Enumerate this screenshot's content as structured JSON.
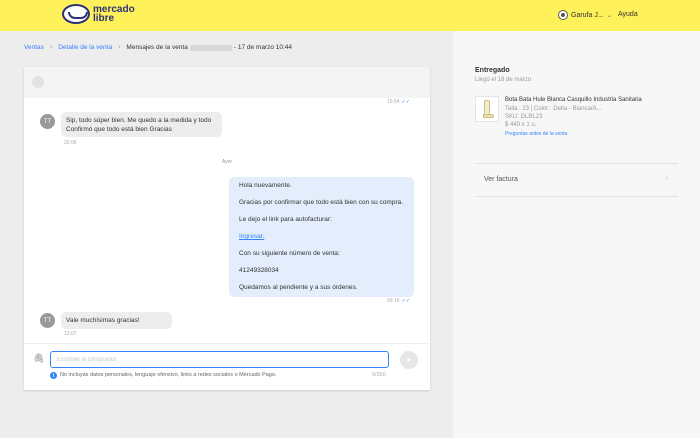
{
  "header": {
    "logo_line1": "mercado",
    "logo_line2": "libre",
    "user_name": "Garufa J...",
    "help": "Ayuda",
    "colors": {
      "topbar": "#fff159",
      "accent": "#3483fa"
    }
  },
  "breadcrumb": {
    "items": [
      "Ventas",
      "Detalle de la venta"
    ],
    "current_prefix": "Mensajes de la venta",
    "current_suffix": "- 17 de marzo 10:44"
  },
  "chat": {
    "top_time": "15:54",
    "messages_in": [
      {
        "avatar": "TT",
        "line1": "Sip, todo súper bien. Me quedo a la medida y todo",
        "line2": "Confirmó que todo está bien Gracias",
        "time": "20:06"
      },
      {
        "avatar": "TT",
        "text": "Vale muchísimas gracias!",
        "time": "12:07"
      }
    ],
    "day_separator": "Ayer",
    "message_out": {
      "line1": "Hola nuevamente.",
      "line2": "Gracias por confirmar que todo está bien con su compra.",
      "line3": "Le dejo el link para autofacturar:",
      "link": "Ingresar.",
      "line5": "Con su siguiente número de venta:",
      "line6": "41249328034",
      "line7": "Quedamos al pendiente y a sus órdenes.",
      "time": "09:16"
    },
    "compose": {
      "placeholder": "Escribile al comprador",
      "info": "No incluyas datos personales, lenguaje ofensivo, links a redes sociales o Mercado Pago.",
      "counter": "0/350"
    }
  },
  "sale": {
    "status": "Entregado",
    "arrived": "Llegó el 18 de marzo",
    "product": {
      "title": "Bota Bata Hule Blanca Casquillo Industria Sanitaria",
      "variation": "Talla : 23 | Color : Delta - Blanca/A...",
      "sku": "SKU: DLBL23",
      "price": "$ 449 x 1 u.",
      "questions_link": "Preguntas antes de la venta"
    },
    "invoice_label": "Ver factura"
  }
}
